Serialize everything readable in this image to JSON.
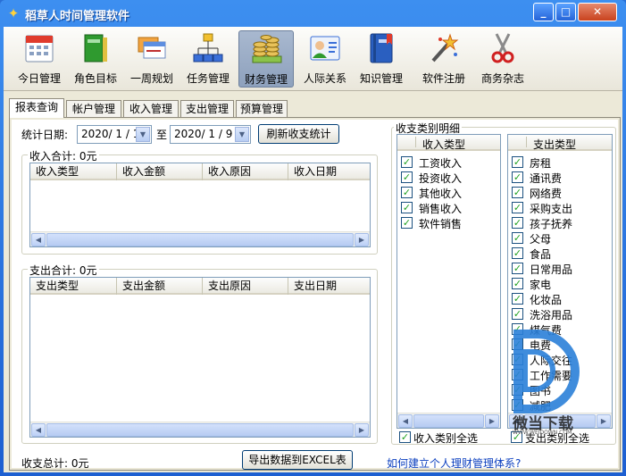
{
  "window": {
    "title": "稻草人时间管理软件"
  },
  "toolbar": [
    {
      "label": "今日管理",
      "icon": "calendar-icon"
    },
    {
      "label": "角色目标",
      "icon": "books-icon"
    },
    {
      "label": "一周规划",
      "icon": "cards-icon"
    },
    {
      "label": "任务管理",
      "icon": "hierarchy-icon"
    },
    {
      "label": "财务管理",
      "icon": "coins-icon"
    },
    {
      "label": "人际关系",
      "icon": "contact-card-icon"
    },
    {
      "label": "知识管理",
      "icon": "book-icon"
    },
    {
      "label": "软件注册",
      "icon": "magic-wand-icon"
    },
    {
      "label": "商务杂志",
      "icon": "scissors-icon"
    }
  ],
  "tabs": [
    "报表查询",
    "帐户管理",
    "收入管理",
    "支出管理",
    "预算管理"
  ],
  "filter": {
    "date_label": "统计日期:",
    "start_date": "2020/ 1 / 1",
    "to_label": "至",
    "end_date": "2020/ 1 / 9",
    "refresh_button": "刷新收支统计"
  },
  "income": {
    "title": "收入合计: 0元",
    "columns": [
      "收入类型",
      "收入金额",
      "收入原因",
      "收入日期"
    ]
  },
  "expense": {
    "title": "支出合计: 0元",
    "columns": [
      "支出类型",
      "支出金额",
      "支出原因",
      "支出日期"
    ]
  },
  "detail": {
    "title": "收支类别明细",
    "income_header": "收入类型",
    "income_types": [
      "工资收入",
      "投资收入",
      "其他收入",
      "销售收入",
      "软件销售"
    ],
    "expense_header": "支出类型",
    "expense_types": [
      "房租",
      "通讯费",
      "网络费",
      "采购支出",
      "孩子抚养",
      "父母",
      "食品",
      "日常用品",
      "家电",
      "化妆品",
      "洗浴用品",
      "煤气费",
      "电费",
      "人际交往",
      "工作需要",
      "图书",
      "减肥"
    ],
    "income_select_all": "收入类别全选",
    "expense_select_all": "支出类别全选"
  },
  "footer": {
    "total": "收支总计: 0元",
    "export_button": "导出数据到EXCEL表",
    "help_link": "如何建立个人理财管理体系?"
  },
  "watermark": {
    "text": "微当下载",
    "url": "WWW.WEIDOWN.COM"
  },
  "colors": {
    "titlebar": "#2a6fd6",
    "accent": "#0b3fbf",
    "check": "#21a121"
  }
}
